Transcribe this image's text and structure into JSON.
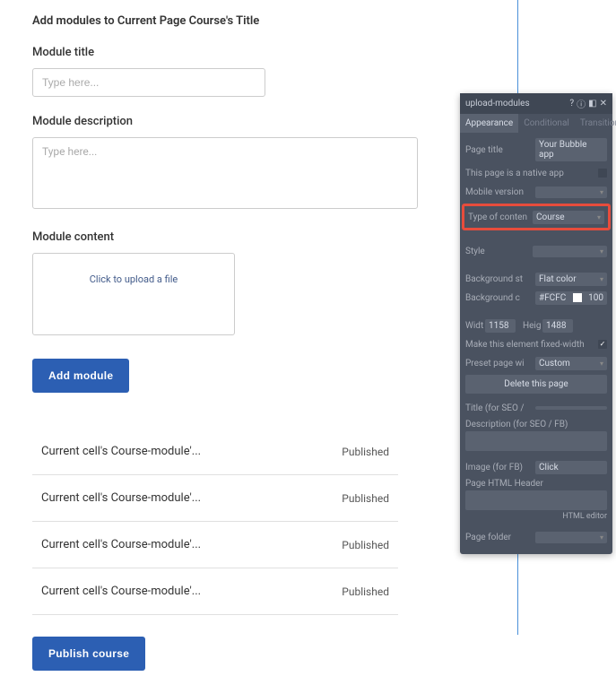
{
  "page_heading": "Add modules to Current Page Course's Title",
  "form": {
    "module_title_label": "Module title",
    "module_title_placeholder": "Type here...",
    "module_description_label": "Module description",
    "module_description_placeholder": "Type here...",
    "module_content_label": "Module content",
    "upload_text": "Click to upload a file",
    "add_module_btn": "Add module",
    "publish_btn": "Publish course"
  },
  "modules": [
    {
      "name": "Current cell's Course-module'...",
      "status": "Published"
    },
    {
      "name": "Current cell's Course-module'...",
      "status": "Published"
    },
    {
      "name": "Current cell's Course-module'...",
      "status": "Published"
    },
    {
      "name": "Current cell's Course-module'...",
      "status": "Published"
    }
  ],
  "panel": {
    "title": "upload-modules",
    "tabs": {
      "appearance": "Appearance",
      "conditional": "Conditional",
      "transitions": "Transitions"
    },
    "page_title_label": "Page title",
    "page_title_value": "Your Bubble app",
    "native_app_label": "This page is a native app",
    "mobile_version_label": "Mobile version",
    "type_content_label": "Type of conten",
    "type_content_value": "Course",
    "style_label": "Style",
    "bg_style_label": "Background st",
    "bg_style_value": "Flat color",
    "bg_color_label": "Background c",
    "bg_color_value": "#FCFC",
    "bg_opacity": "100",
    "width_label": "Widt",
    "width_value": "1158",
    "height_label": "Heig",
    "height_value": "1488",
    "fixed_width_label": "Make this element fixed-width",
    "preset_width_label": "Preset page wi",
    "preset_width_value": "Custom",
    "delete_btn": "Delete this page",
    "seo_title_label": "Title (for SEO /",
    "seo_desc_label": "Description (for SEO / FB)",
    "fb_image_label": "Image (for FB)",
    "fb_image_value": "Click",
    "html_header_label": "Page HTML Header",
    "html_editor": "HTML editor",
    "folder_label": "Page folder"
  }
}
